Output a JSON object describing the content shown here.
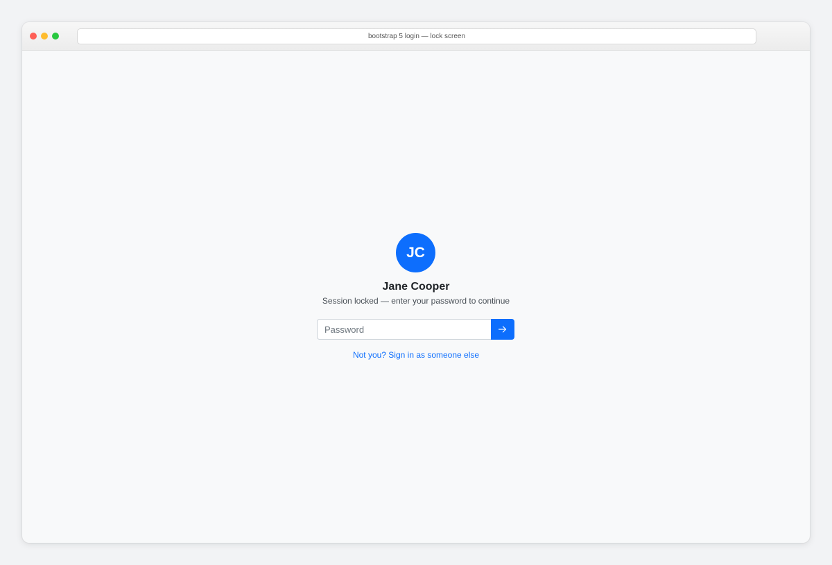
{
  "browser": {
    "url_title": "bootstrap 5 login — lock screen"
  },
  "lock_screen": {
    "avatar_initials": "JC",
    "user_name": "Jane Cooper",
    "message": "Session locked — enter your password to continue",
    "password_placeholder": "Password",
    "password_value": "",
    "submit_icon": "arrow-right-icon",
    "switch_user_link": "Not you? Sign in as someone else"
  },
  "colors": {
    "primary": "#0d6efd",
    "page_background": "#f8f9fa",
    "text": "#212529",
    "muted_text": "#495057"
  }
}
